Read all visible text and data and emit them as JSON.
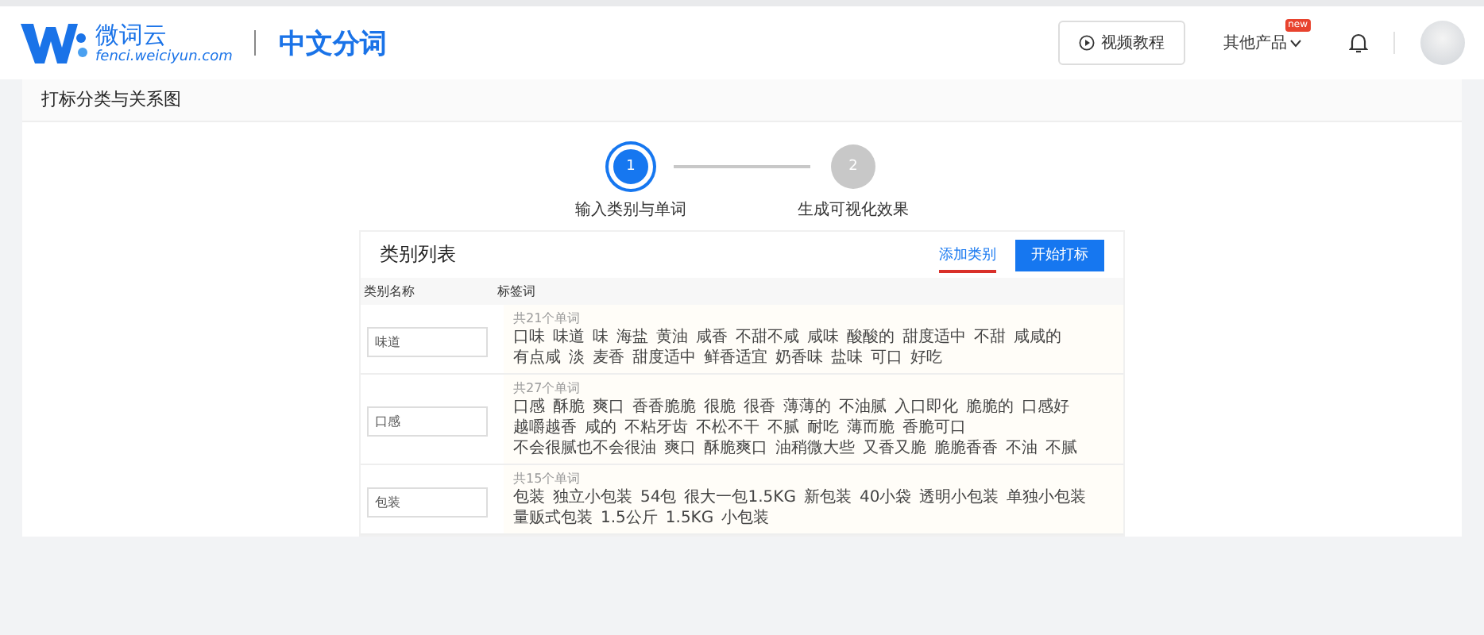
{
  "header": {
    "logo_name": "微词云",
    "logo_domain": "fenci.weiciyun.com",
    "product": "中文分词",
    "video_button": "视频教程",
    "other_products": "其他产品",
    "new_badge": "new"
  },
  "page_title": "打标分类与关系图",
  "steps": [
    {
      "number": "1",
      "label": "输入类别与单词",
      "selected": true
    },
    {
      "number": "2",
      "label": "生成可视化效果",
      "selected": false
    }
  ],
  "panel": {
    "title": "类别列表",
    "add_link": "添加类别",
    "start_button": "开始打标",
    "columns": [
      "类别名称",
      "标签词"
    ],
    "rows": [
      {
        "name": "味道",
        "count": "共21个单词",
        "tags": [
          "口味",
          "味道",
          "味",
          "海盐",
          "黄油",
          "咸香",
          "不甜不咸",
          "咸味",
          "酸酸的",
          "甜度适中",
          "不甜",
          "咸咸的",
          "有点咸",
          "淡",
          "麦香",
          "甜度适中",
          "鲜香适宜",
          "奶香味",
          "盐味",
          "可口",
          "好吃"
        ]
      },
      {
        "name": "口感",
        "count": "共27个单词",
        "tags": [
          "口感",
          "酥脆",
          "爽口",
          "香香脆脆",
          "很脆",
          "很香",
          "薄薄的",
          "不油腻",
          "入口即化",
          "脆脆的",
          "口感好",
          "越嚼越香",
          "咸的",
          "不粘牙齿",
          "不松不干",
          "不腻",
          "耐吃",
          "薄而脆",
          "香脆可口",
          "不会很腻也不会很油",
          "爽口",
          "酥脆爽口",
          "油稍微大些",
          "又香又脆",
          "脆脆香香",
          "不油",
          "不腻"
        ]
      },
      {
        "name": "包装",
        "count": "共15个单词",
        "tags": [
          "包装",
          "独立小包装",
          "54包",
          "很大一包1.5KG",
          "新包装",
          "40小袋",
          "透明小包装",
          "单独小包装",
          "量贩式包装",
          "1.5公斤",
          "1.5KG",
          "小包装"
        ]
      }
    ]
  }
}
